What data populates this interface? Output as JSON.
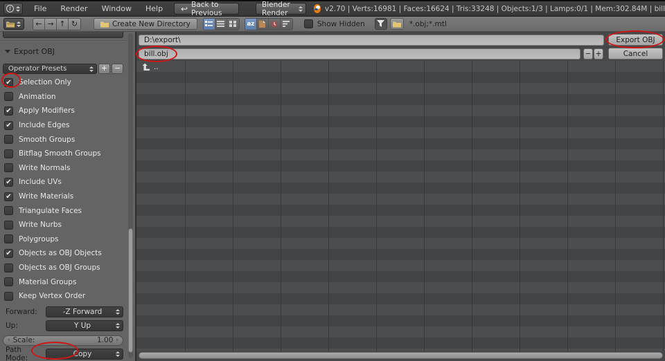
{
  "topbar": {
    "menus": [
      "File",
      "Render",
      "Window",
      "Help"
    ],
    "back_button": "Back to Previous",
    "engine_select": "Blender Render",
    "stats": "v2.70 | Verts:16981 | Faces:16624 | Tris:33248 | Objects:1/3 | Lamps:0/1 | Mem:302.84M | bill"
  },
  "browser_header": {
    "create_dir_button": "Create New Directory",
    "show_hidden_label": "Show Hidden",
    "filter_text": "*.obj;*.mtl",
    "sort_alpha_glyph": "az"
  },
  "export_panel": {
    "title": "Export OBJ",
    "presets_label": "Operator Presets",
    "add_preset": "+",
    "remove_preset": "−",
    "options": [
      {
        "label": "Selection Only",
        "checked": true
      },
      {
        "label": "Animation",
        "checked": false
      },
      {
        "label": "Apply Modifiers",
        "checked": true
      },
      {
        "label": "Include Edges",
        "checked": true
      },
      {
        "label": "Smooth Groups",
        "checked": false
      },
      {
        "label": "Bitflag Smooth Groups",
        "checked": false
      },
      {
        "label": "Write Normals",
        "checked": false
      },
      {
        "label": "Include UVs",
        "checked": true
      },
      {
        "label": "Write Materials",
        "checked": true
      },
      {
        "label": "Triangulate Faces",
        "checked": false
      },
      {
        "label": "Write Nurbs",
        "checked": false
      },
      {
        "label": "Polygroups",
        "checked": false
      },
      {
        "label": "Objects as OBJ Objects",
        "checked": true
      },
      {
        "label": "Objects as OBJ Groups",
        "checked": false
      },
      {
        "label": "Material Groups",
        "checked": false
      },
      {
        "label": "Keep Vertex Order",
        "checked": false
      }
    ],
    "forward": {
      "label": "Forward:",
      "value": "-Z Forward"
    },
    "up": {
      "label": "Up:",
      "value": "Y Up"
    },
    "scale": {
      "label": "Scale:",
      "value": "1.00"
    },
    "path_mode": {
      "label": "Path Mode:",
      "value": "Copy"
    }
  },
  "file_browser": {
    "path": "D:\\export\\",
    "filename": "bill.obj",
    "export_button": "Export OBJ",
    "cancel_button": "Cancel",
    "minus_button": "−",
    "plus_button": "+",
    "parent_entry": ".."
  },
  "colors": {
    "accent_blue": "#5c7dab",
    "annotation_red": "#cf1616",
    "blender_orange": "#e87d0d"
  }
}
